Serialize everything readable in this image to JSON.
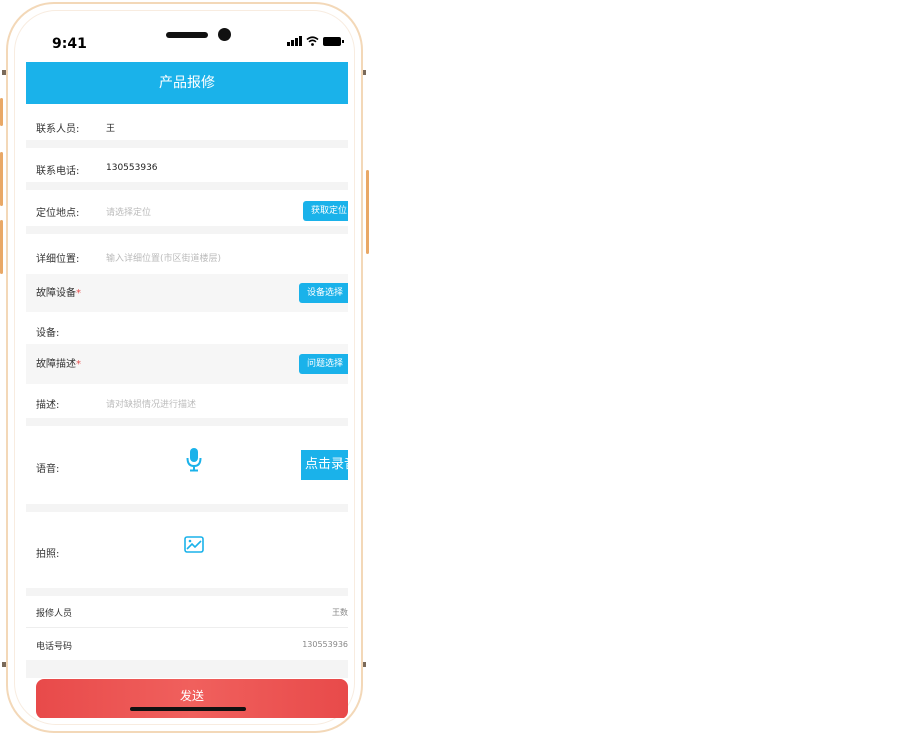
{
  "status_bar": {
    "time": "9:41"
  },
  "header": {
    "title": "产品报修"
  },
  "form": {
    "contact_label": "联系人员:",
    "contact_value": "王",
    "phone_label": "联系电话:",
    "phone_value": "130553936",
    "location_label": "定位地点:",
    "location_placeholder": "请选择定位",
    "location_button": "获取定位",
    "address_label": "详细位置:",
    "address_placeholder": "输入详细位置(市区街道楼层)",
    "fault_device_label": "故障设备",
    "required_mark": "*",
    "device_select_button": "设备选择",
    "device_label": "设备:",
    "fault_desc_label": "故障描述",
    "problem_select_button": "问题选择",
    "desc_label": "描述:",
    "desc_placeholder": "请对缺损情况进行描述",
    "voice_label": "语音:",
    "record_button": "点击录音",
    "photo_label": "拍照:"
  },
  "info": {
    "reporter_label": "报修人员",
    "reporter_value": "王数",
    "tel_label": "电话号码",
    "tel_value": "130553936"
  },
  "footer": {
    "send_button": "发送"
  },
  "colors": {
    "accent": "#1ab2ea",
    "send": "#e84a4a",
    "required": "#e64c4c"
  },
  "icons": [
    "signal-icon",
    "wifi-icon",
    "battery-icon",
    "microphone-icon",
    "image-icon"
  ]
}
